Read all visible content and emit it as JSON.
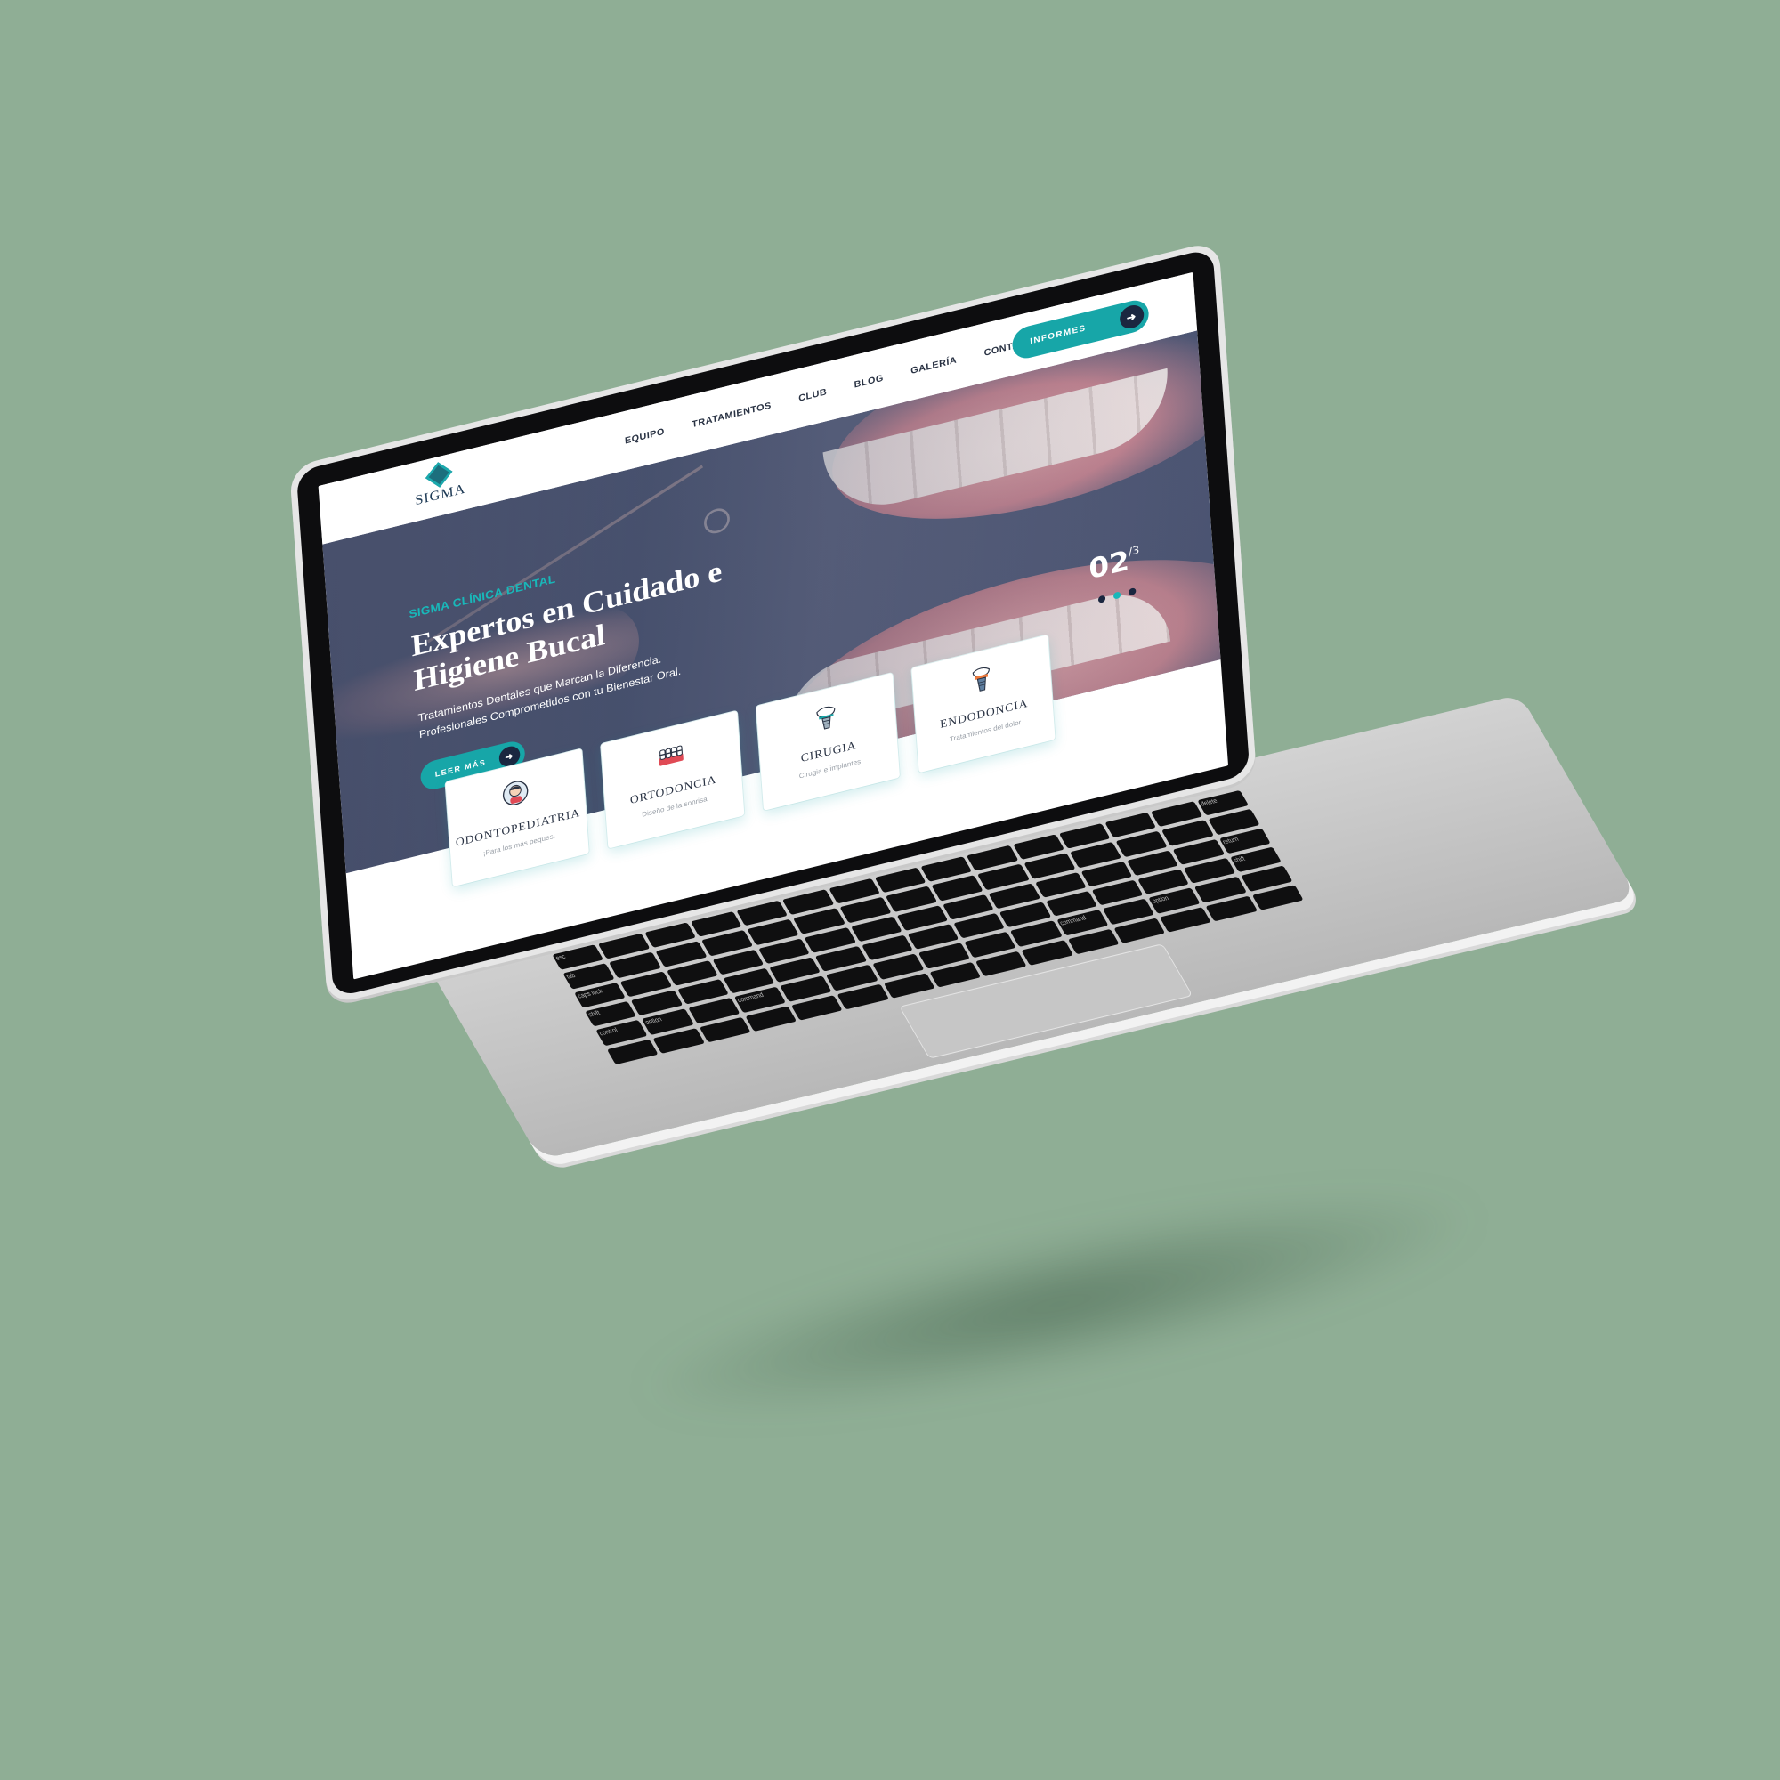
{
  "colors": {
    "background": "#8fae95",
    "accent": "#17a6a8",
    "navy": "#1b2740",
    "text_dark": "#2a3344"
  },
  "site": {
    "logo_text": "SIGMA",
    "nav": {
      "items": [
        "EQUIPO",
        "TRATAMIENTOS",
        "CLUB",
        "BLOG",
        "GALERÍA",
        "CONTACTO"
      ],
      "cta_label": "INFORMES",
      "cta_icon": "arrow-right-icon"
    },
    "hero": {
      "kicker": "SIGMA CLÍNICA DENTAL",
      "headline": "Expertos en Cuidado e Higiene Bucal",
      "lead_line1": "Tratamientos Dentales que Marcan la Diferencia.",
      "lead_line2": "Profesionales Comprometidos con tu Bienestar Oral.",
      "button_label": "LEER MÁS",
      "button_icon": "arrow-right-icon",
      "slide_current": "02",
      "slide_total": "/3",
      "active_dot": 2
    },
    "cards": [
      {
        "title": "ODONTOPEDIATRIA",
        "desc": "¡Para los más peques!",
        "icon": "child-icon"
      },
      {
        "title": "ORTODONCIA",
        "desc": "Diseño de la sonrisa",
        "icon": "braces-icon"
      },
      {
        "title": "CIRUGIA",
        "desc": "Cirugia e implantes",
        "icon": "implant-icon"
      },
      {
        "title": "ENDODONCIA",
        "desc": "Tratamientos del dolor",
        "icon": "tooth-implant-icon"
      }
    ]
  },
  "keyboard": {
    "labels": [
      "esc",
      "tab",
      "caps lock",
      "shift",
      "control",
      "option",
      "command",
      "command",
      "option",
      "delete",
      "return",
      "shift"
    ]
  }
}
